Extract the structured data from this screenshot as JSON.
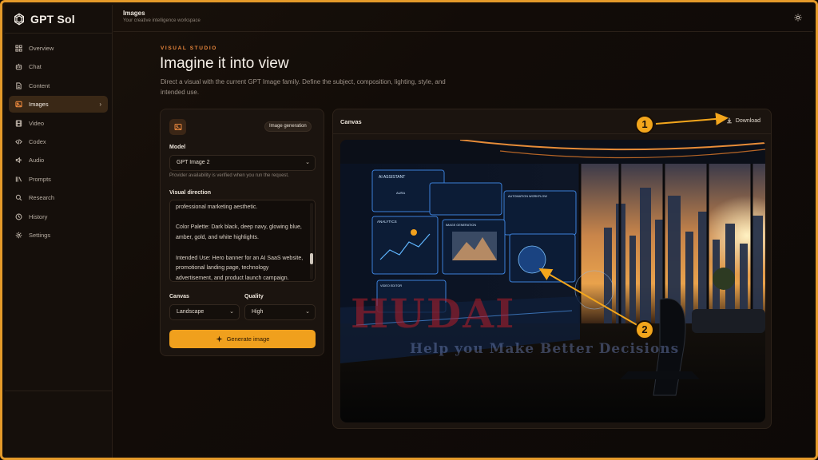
{
  "app": {
    "name": "GPT Sol"
  },
  "header": {
    "title": "Images",
    "subtitle": "Your creative intelligence workspace"
  },
  "sidebar": {
    "items": [
      {
        "label": "Overview",
        "icon": "grid-icon",
        "active": false
      },
      {
        "label": "Chat",
        "icon": "chat-bot-icon",
        "active": false
      },
      {
        "label": "Content",
        "icon": "document-icon",
        "active": false
      },
      {
        "label": "Images",
        "icon": "image-icon",
        "active": true
      },
      {
        "label": "Video",
        "icon": "film-icon",
        "active": false
      },
      {
        "label": "Codex",
        "icon": "code-icon",
        "active": false
      },
      {
        "label": "Audio",
        "icon": "audio-icon",
        "active": false
      },
      {
        "label": "Prompts",
        "icon": "library-icon",
        "active": false
      },
      {
        "label": "Research",
        "icon": "search-icon",
        "active": false
      },
      {
        "label": "History",
        "icon": "history-icon",
        "active": false
      },
      {
        "label": "Settings",
        "icon": "gear-icon",
        "active": false
      }
    ]
  },
  "hero": {
    "eyebrow": "VISUAL STUDIO",
    "title": "Imagine it into view",
    "subtitle": "Direct a visual with the current GPT Image family. Define the subject, composition, lighting, style, and intended use."
  },
  "controls": {
    "mode_pill": "Image generation",
    "model_label": "Model",
    "model_value": "GPT Image 2",
    "model_hint": "Provider availability is verified when you run the request.",
    "direction_label": "Visual direction",
    "direction_text": "professional marketing aesthetic.\n\nColor Palette: Dark black, deep navy, glowing blue, amber, gold, and white highlights.\n\nIntended Use: Hero banner for an AI SaaS website, promotional landing page, technology advertisement, and product launch campaign.",
    "canvas_label": "Canvas",
    "canvas_value": "Landscape",
    "quality_label": "Quality",
    "quality_value": "High",
    "generate_label": "Generate image"
  },
  "canvas": {
    "title": "Canvas",
    "download_label": "Download"
  },
  "annotations": {
    "badge_1": "1",
    "badge_2": "2",
    "watermark_logo": "HUDAI",
    "watermark_tagline": "Help you Make Better Decisions"
  },
  "image_labels": {
    "panel_1": "AI ASSISTANT",
    "panel_2": "ANALYTICS",
    "panel_3": "IMAGE GENERATION",
    "panel_4": "AUTOMATION WORKFLOW",
    "panel_5": "VIDEO EDITOR",
    "aura": "AURA"
  },
  "colors": {
    "accent": "#f0a01d",
    "eyebrow": "#e9873d",
    "frame": "#e49a2a",
    "active_nav": "#3a2816"
  }
}
